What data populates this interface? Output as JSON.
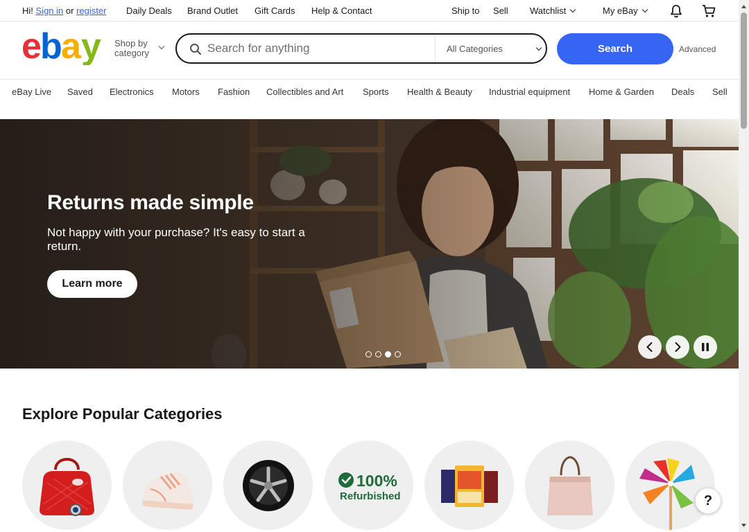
{
  "topbar": {
    "greeting": "Hi!",
    "sign_in": "Sign in",
    "or": "or",
    "register": "register",
    "daily_deals": "Daily Deals",
    "brand_outlet": "Brand Outlet",
    "gift_cards": "Gift Cards",
    "help_contact": "Help & Contact",
    "ship_to": "Ship to",
    "sell": "Sell",
    "watchlist": "Watchlist",
    "my_ebay": "My eBay",
    "icons": [
      "bell-icon",
      "cart-icon"
    ]
  },
  "header": {
    "logo_letters": [
      "e",
      "b",
      "a",
      "y"
    ],
    "logo_colors": [
      "#e53238",
      "#0064d2",
      "#f5af02",
      "#86b817"
    ],
    "shop_by_line1": "Shop by",
    "shop_by_line2": "category",
    "search_placeholder": "Search for anything",
    "category_selected": "All Categories",
    "search_button": "Search",
    "advanced": "Advanced"
  },
  "nav": {
    "items": [
      "eBay Live",
      "Saved",
      "Electronics",
      "Motors",
      "Fashion",
      "Collectibles and Art",
      "Sports",
      "Health & Beauty",
      "Industrial equipment",
      "Home & Garden",
      "Deals",
      "Sell"
    ]
  },
  "hero": {
    "title": "Returns made simple",
    "subtitle": "Not happy with your purchase? It's easy to start a return.",
    "cta": "Learn more",
    "slide_count": 4,
    "active_slide": 3
  },
  "explore": {
    "title": "Explore Popular Categories",
    "refurbished_line1": "100%",
    "refurbished_line2": "Refurbished",
    "categories": [
      "handbag-watch-image",
      "sneaker-image",
      "wheel-rim-image",
      "refurbished-badge",
      "trading-cards-image",
      "tote-bag-image",
      "pinwheel-image"
    ]
  },
  "help": {
    "label": "?"
  },
  "colors": {
    "accent": "#3665f3",
    "refurbished_green": "#1f6b3a"
  }
}
